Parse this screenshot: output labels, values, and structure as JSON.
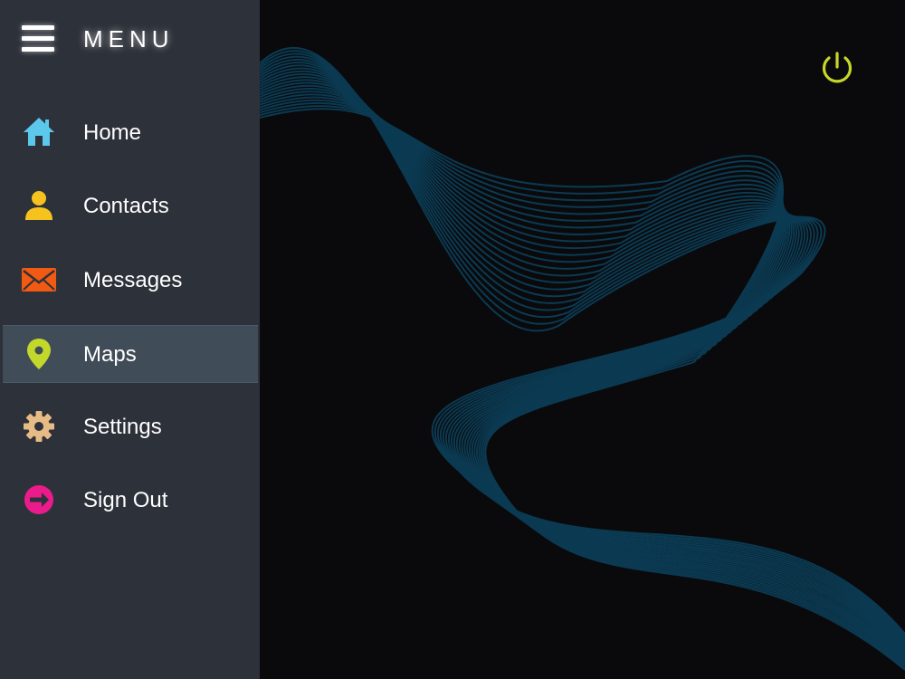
{
  "header": {
    "title": "MENU"
  },
  "nav": {
    "items": [
      {
        "label": "Home",
        "icon": "home-icon",
        "color": "#5bc8ec"
      },
      {
        "label": "Contacts",
        "icon": "user-icon",
        "color": "#f6c21d"
      },
      {
        "label": "Messages",
        "icon": "envelope-icon",
        "color": "#f25a14"
      },
      {
        "label": "Maps",
        "icon": "map-pin-icon",
        "color": "#c2d82b",
        "active": true
      },
      {
        "label": "Settings",
        "icon": "gear-icon",
        "color": "#e7bb86"
      },
      {
        "label": "Sign Out",
        "icon": "sign-out-icon",
        "color": "#ec1b8c"
      }
    ]
  },
  "main": {
    "power_icon_color": "#c6d729",
    "wave_color": "#0b3a52"
  },
  "colors": {
    "sidebar_bg": "#2d3139",
    "active_item_bg": "#414c59",
    "main_bg": "#0a0a0c"
  }
}
